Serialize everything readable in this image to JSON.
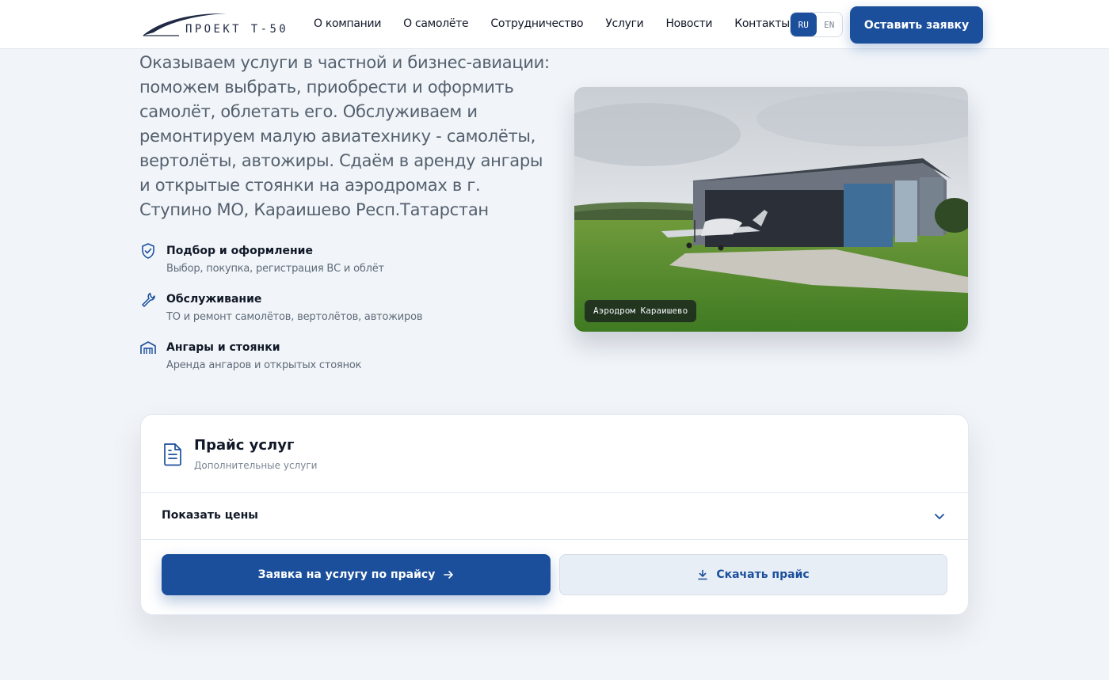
{
  "header": {
    "logo_text": "ПРОЕКТ Т-50",
    "nav": [
      {
        "label": "О компании"
      },
      {
        "label": "О самолёте"
      },
      {
        "label": "Сотрудничество"
      },
      {
        "label": "Услуги"
      },
      {
        "label": "Новости"
      },
      {
        "label": "Контакты"
      }
    ],
    "lang": {
      "active": "RU",
      "inactive": "EN"
    },
    "cta_label": "Оставить заявку"
  },
  "hero": {
    "text": "Оказываем услуги в частной и бизнес-авиации: поможем выбрать, приобрести и оформить самолёт, облетать его. Обслуживаем и ремонтируем малую авиатехнику - самолёты, вертолёты, автожиры. Сдаём в аренду ангары и открытые стоянки на аэродромах в г. Ступино МО, Караишево Респ.Татарстан",
    "features": [
      {
        "icon": "shield-check-icon",
        "title": "Подбор и оформление",
        "desc": "Выбор, покупка, регистрация ВС и облёт"
      },
      {
        "icon": "wrench-icon",
        "title": "Обслуживание",
        "desc": "ТО и ремонт самолётов, вертолётов, автожиров"
      },
      {
        "icon": "hangar-icon",
        "title": "Ангары и стоянки",
        "desc": "Аренда ангаров и открытых стоянок"
      }
    ],
    "photo_caption": "Аэродром Караишево"
  },
  "price_card": {
    "title": "Прайс услуг",
    "subtitle": "Дополнительные услуги",
    "toggle_label": "Показать цены",
    "request_button": "Заявка на услугу по прайсу",
    "download_button": "Скачать прайс"
  },
  "colors": {
    "accent": "#1b4f9c",
    "background": "#f1f5f9"
  }
}
